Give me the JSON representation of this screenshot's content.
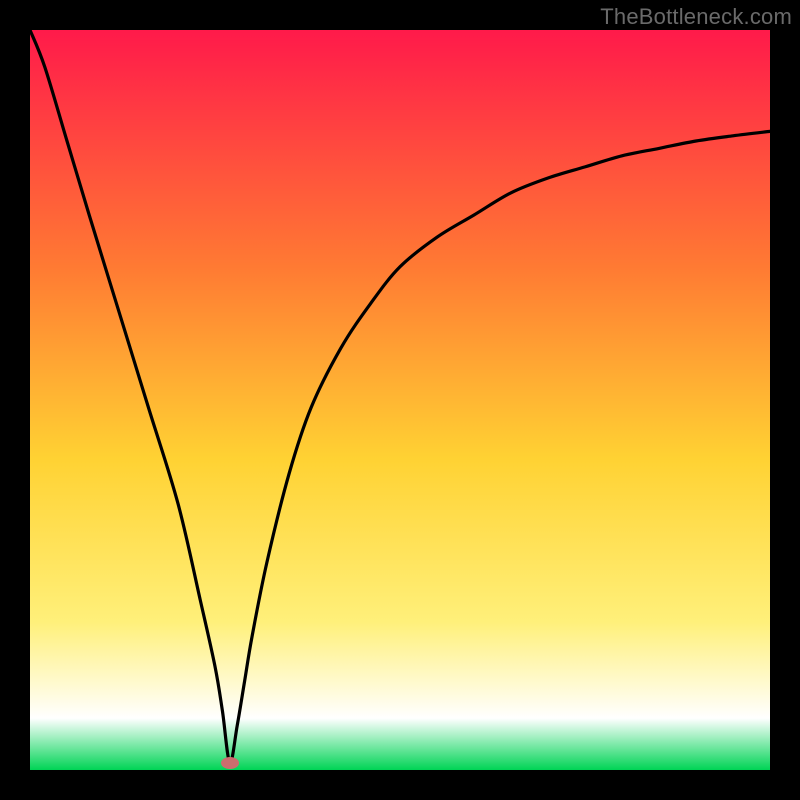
{
  "watermark": "TheBottleneck.com",
  "colors": {
    "frame": "#000000",
    "gradient_top": "#ff1a4a",
    "gradient_mid1": "#ff7a33",
    "gradient_mid2": "#ffd233",
    "gradient_mid3": "#fff07a",
    "gradient_mid4": "#ffffff",
    "gradient_bottom": "#00d455",
    "curve": "#000000",
    "marker": "#cc6d6e"
  },
  "chart_data": {
    "type": "line",
    "title": "",
    "xlabel": "",
    "ylabel": "",
    "xlim": [
      0,
      100
    ],
    "ylim": [
      0,
      100
    ],
    "grid": false,
    "legend_position": "none",
    "annotations": [
      {
        "type": "marker",
        "x": 27,
        "y": 1,
        "shape": "ellipse",
        "color": "#cc6d6e"
      }
    ],
    "series": [
      {
        "name": "curve",
        "x": [
          0,
          2,
          5,
          8,
          12,
          16,
          20,
          23,
          25,
          26,
          27,
          28,
          29,
          30,
          32,
          35,
          38,
          42,
          46,
          50,
          55,
          60,
          65,
          70,
          75,
          80,
          85,
          90,
          95,
          100
        ],
        "values": [
          100,
          95,
          85,
          75,
          62,
          49,
          36,
          23,
          14,
          8,
          1,
          6,
          12,
          18,
          28,
          40,
          49,
          57,
          63,
          68,
          72,
          75,
          78,
          80,
          81.5,
          83,
          84,
          85,
          85.7,
          86.3
        ]
      }
    ]
  }
}
